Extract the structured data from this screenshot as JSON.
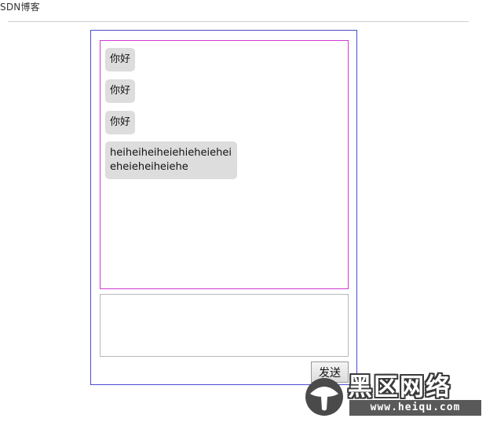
{
  "header": {
    "site_label": "SDN博客"
  },
  "chat": {
    "messages": [
      {
        "text": "你好"
      },
      {
        "text": "你好"
      },
      {
        "text": "你好"
      },
      {
        "text": "heiheiheiheiehieheiehei eheieheiheiehe"
      }
    ],
    "input": {
      "value": "",
      "placeholder": ""
    },
    "send_label": "发送"
  },
  "watermark": {
    "title": "黑区网络",
    "url": "www.heiqu.com"
  },
  "colors": {
    "frame_border": "#4a4ad4",
    "message_area_border": "#d23ad2",
    "bubble_background": "#dddddd"
  }
}
